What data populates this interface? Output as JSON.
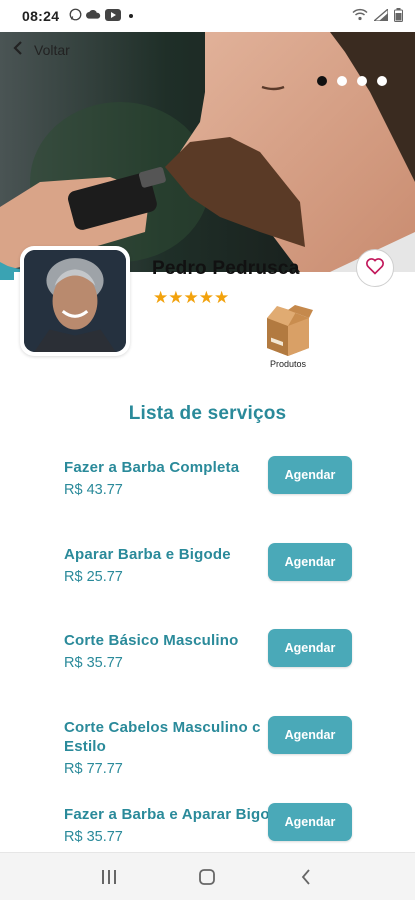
{
  "status_bar": {
    "time": "08:24",
    "icons": [
      "whatsapp-icon",
      "cloud-icon",
      "youtube-icon",
      "notification-dot-icon",
      "wifi-icon",
      "signal-icon",
      "battery-icon"
    ]
  },
  "header": {
    "back_label": "Voltar",
    "carousel_dots": 4,
    "active_dot": 0
  },
  "profile": {
    "name": "Pedro Pedrusca",
    "rating": "★★★★★",
    "products_label": "Produtos"
  },
  "services_title": "Lista de serviços",
  "services": [
    {
      "name": "Fazer a Barba Completa",
      "price": "R$ 43.77",
      "button": "Agendar"
    },
    {
      "name": "Aparar Barba e Bigode",
      "price": "R$ 25.77",
      "button": "Agendar"
    },
    {
      "name": "Corte Básico Masculino",
      "price": "R$ 35.77",
      "button": "Agendar"
    },
    {
      "name": "Corte Cabelos Masculino  c Estilo",
      "price": "R$ 77.77",
      "button": "Agendar"
    },
    {
      "name": "Fazer a Barba e Aparar Bigode",
      "price": "R$ 35.77",
      "button": "Agendar"
    }
  ],
  "colors": {
    "accent": "#2a8a9a",
    "button": "#4aa9b8",
    "star": "#f2a20d"
  },
  "nav": [
    "recent-apps-icon",
    "home-icon",
    "back-icon"
  ]
}
